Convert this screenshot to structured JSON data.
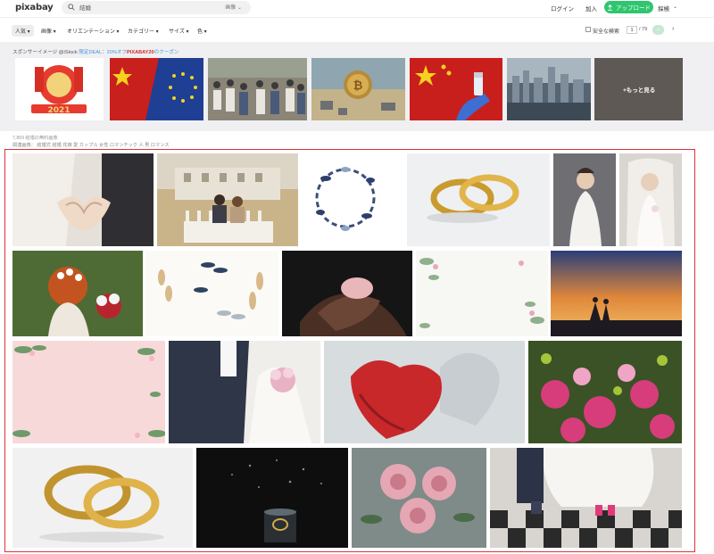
{
  "header": {
    "logo": "pixabay",
    "search_value": "結婚",
    "search_type": "画像",
    "login": "ログイン",
    "join": "加入",
    "upload": "アップロード",
    "explore": "探検"
  },
  "filters": {
    "items": [
      "人気",
      "画像",
      "オリエンテーション",
      "カテゴリー",
      "サイズ",
      "色"
    ],
    "safe_search": "安全な検索",
    "page_current": "1",
    "page_total": "/ 79"
  },
  "sponsor": {
    "prefix": "スポンサーイメージ @iStock",
    "deal": "限定DEAL：20%オフ",
    "code": "PIXABAY20",
    "suffix": "のクーポン",
    "more": "+もっと見る"
  },
  "results": {
    "count": "7,869 結婚の無料画像",
    "related_label": "関連画像：",
    "related_tags": [
      "結婚式",
      "結婚",
      "花嫁",
      "愛",
      "カップル",
      "女性",
      "ロマンチック",
      "人",
      "男",
      "ロマンス"
    ]
  },
  "icons": {
    "search": "search-icon",
    "upload": "upload-icon",
    "chevron": "chevron-down-icon",
    "checkbox": "checkbox-icon",
    "next": "arrow-right-icon"
  },
  "colors": {
    "accent": "#2ec66e",
    "highlight_frame": "#e0303a",
    "deal": "#4a90d9",
    "code": "#d62929"
  }
}
